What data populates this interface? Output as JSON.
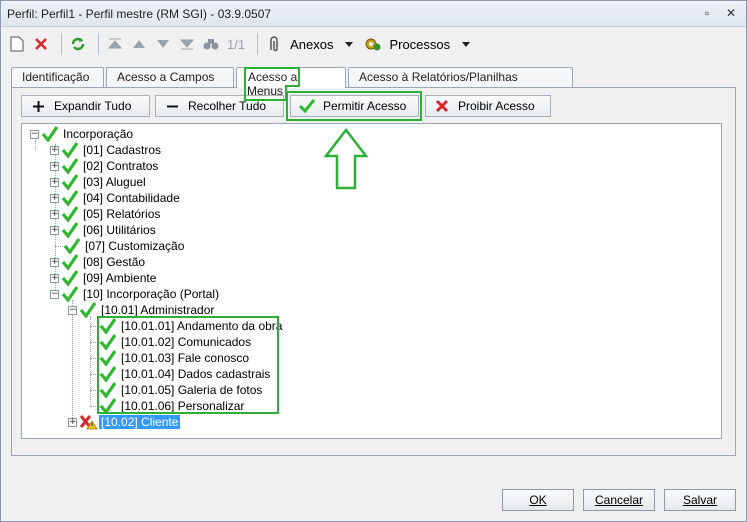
{
  "window": {
    "title": "Perfil: Perfil1 - Perfil mestre (RM SGI) - 03.9.0507"
  },
  "toolbar": {
    "record_counter": "1/1",
    "anexos_label": "Anexos",
    "processos_label": "Processos"
  },
  "tabs": [
    {
      "label": "Identificação"
    },
    {
      "label": "Acesso a Campos"
    },
    {
      "label": "Acesso a Menus"
    },
    {
      "label": "Acesso à Relatórios/Planilhas"
    }
  ],
  "actions": {
    "expand": "Expandir Tudo",
    "collapse": "Recolher Tudo",
    "allow": "Permitir Acesso",
    "deny": "Proibir Acesso"
  },
  "tree": {
    "root": "Incorporação",
    "items": [
      "[01] Cadastros",
      "[02] Contratos",
      "[03] Aluguel",
      "[04] Contabilidade",
      "[05] Relatórios",
      "[06] Utilitários",
      "[07] Customização",
      "[08] Gestão",
      "[09] Ambiente",
      "[10] Incorporação (Portal)"
    ],
    "admin": "[10.01] Administrador",
    "admin_children": [
      "[10.01.01] Andamento da obra",
      "[10.01.02] Comunicados",
      "[10.01.03] Fale conosco",
      "[10.01.04] Dados cadastrais",
      "[10.01.05] Galeria de fotos",
      "[10.01.06] Personalizar"
    ],
    "cliente": "[10.02] Cliente"
  },
  "footer": {
    "ok": "OK",
    "cancel": "Cancelar",
    "save": "Salvar"
  },
  "colors": {
    "highlight": "#2db035",
    "check": "#2eb82e",
    "deny": "#d9262b",
    "selection": "#3399ff"
  }
}
